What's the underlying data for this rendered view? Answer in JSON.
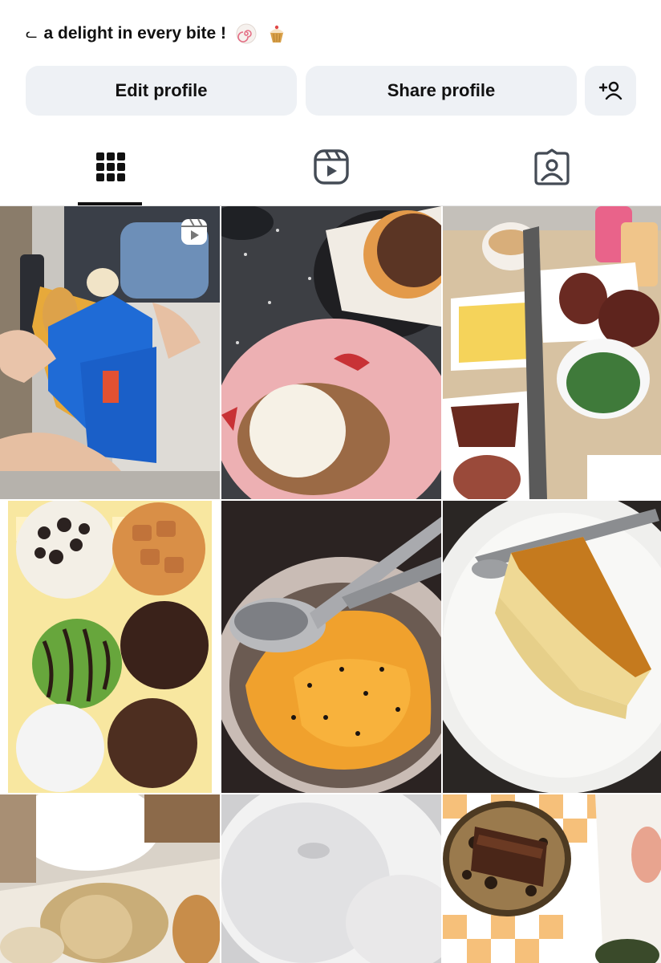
{
  "profile": {
    "bio_text": "a delight in every bite !",
    "bio_emojis": [
      "fish-cake-emoji",
      "cupcake-emoji"
    ]
  },
  "actions": {
    "edit_label": "Edit profile",
    "share_label": "Share profile",
    "add_person_icon": "add-person-icon"
  },
  "tabs": {
    "active": "grid",
    "items": [
      "grid-icon",
      "reels-icon",
      "tagged-icon"
    ]
  },
  "grid": {
    "posts": [
      {
        "subject": "fried skewers in blue paper sleeves",
        "reel": true
      },
      {
        "subject": "ice cream on cookie crumble with donut"
      },
      {
        "subject": "fried chicken meal with fries and drink"
      },
      {
        "subject": "box of six assorted donuts"
      },
      {
        "subject": "orange cheese rice bowl with spoon"
      },
      {
        "subject": "slice of basque cheesecake"
      },
      {
        "subject": "drinks and fried snacks"
      },
      {
        "subject": "sugar powdered donuts"
      },
      {
        "subject": "cookie with chocolate bar in checkered box"
      }
    ]
  },
  "colors": {
    "button_bg": "#eef1f5",
    "text": "#111111",
    "icon": "#444b55"
  }
}
